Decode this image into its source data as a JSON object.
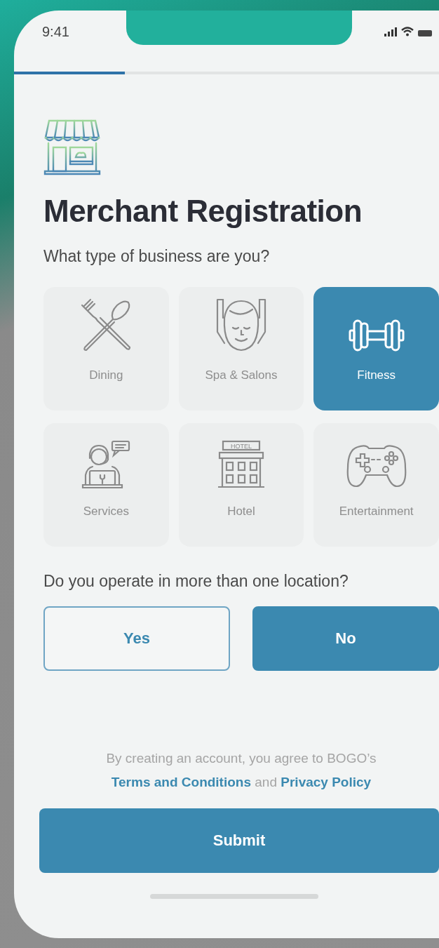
{
  "status_bar": {
    "time": "9:41"
  },
  "progress": {
    "level": 0.26
  },
  "title": "Merchant Registration",
  "business_question": "What type of business are you?",
  "business_types": [
    {
      "kind": "dining",
      "label": "Dining",
      "selected": false
    },
    {
      "kind": "spa",
      "label": "Spa & Salons",
      "selected": false
    },
    {
      "kind": "fitness",
      "label": "Fitness",
      "selected": true
    },
    {
      "kind": "services",
      "label": "Services",
      "selected": false
    },
    {
      "kind": "hotel",
      "label": "Hotel",
      "selected": false,
      "sign": "HOTEL"
    },
    {
      "kind": "entertainment",
      "label": "Entertainment",
      "selected": false
    }
  ],
  "location_question": "Do you operate in more than one location?",
  "location_options": [
    {
      "label": "Yes",
      "selected": false
    },
    {
      "label": "No",
      "selected": true
    }
  ],
  "terms": {
    "text": "By creating an account, you agree to BOGO’s",
    "terms_link": "Terms and Conditions",
    "joiner": "and",
    "privacy_link": "Privacy Policy"
  },
  "submit": "Submit"
}
